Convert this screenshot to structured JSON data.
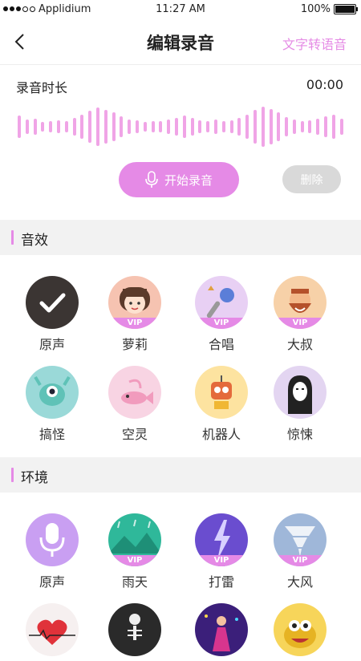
{
  "status_bar": {
    "carrier": "Applidium",
    "time": "11:27 AM",
    "battery": "100%"
  },
  "navbar": {
    "title": "编辑录音",
    "action": "文字转语音"
  },
  "recording": {
    "duration_label": "录音时长",
    "duration_value": "00:00",
    "record_button": "开始录音",
    "delete_button": "删除"
  },
  "sections": {
    "effects": {
      "title": "音效",
      "items": [
        {
          "label": "原声",
          "vip": false,
          "bg": "#3b3533",
          "icon": "checkmark-icon"
        },
        {
          "label": "萝莉",
          "vip": true,
          "vip_label": "VIP",
          "bg": "#f6c3b1",
          "icon": "girl-face-icon"
        },
        {
          "label": "合唱",
          "vip": true,
          "vip_label": "VIP",
          "bg": "#e8d0f4",
          "icon": "microphone-icon"
        },
        {
          "label": "大叔",
          "vip": true,
          "vip_label": "VIP",
          "bg": "#f7d1a8",
          "icon": "bearded-man-icon"
        },
        {
          "label": "搞怪",
          "vip": false,
          "bg": "#9ad9d8",
          "icon": "monster-icon"
        },
        {
          "label": "空灵",
          "vip": false,
          "bg": "#f8d4e3",
          "icon": "fish-icon"
        },
        {
          "label": "机器人",
          "vip": false,
          "bg": "#fde3a0",
          "icon": "robot-icon"
        },
        {
          "label": "惊悚",
          "vip": false,
          "bg": "#e3d5f1",
          "icon": "ghost-mask-icon"
        }
      ]
    },
    "environment": {
      "title": "环境",
      "items": [
        {
          "label": "原声",
          "vip": false,
          "bg": "#c99ff2",
          "icon": "studio-mic-icon"
        },
        {
          "label": "雨天",
          "vip": true,
          "vip_label": "VIP",
          "bg": "#2fb89a",
          "icon": "rain-mountain-icon"
        },
        {
          "label": "打雷",
          "vip": true,
          "vip_label": "VIP",
          "bg": "#6a4dcf",
          "icon": "lightning-icon"
        },
        {
          "label": "大风",
          "vip": true,
          "vip_label": "VIP",
          "bg": "#9fb7d9",
          "icon": "tornado-icon"
        },
        {
          "label": "",
          "vip": false,
          "bg": "#f6f0f0",
          "icon": "heart-pulse-icon"
        },
        {
          "label": "",
          "vip": false,
          "bg": "#2a2a2a",
          "icon": "skeleton-icon"
        },
        {
          "label": "",
          "vip": false,
          "bg": "#3b1f7a",
          "icon": "disco-icon"
        },
        {
          "label": "",
          "vip": false,
          "bg": "#f7d55a",
          "icon": "monster-smile-icon"
        }
      ]
    }
  },
  "colors": {
    "accent": "#e58ae6",
    "wave": "#f0a4e6",
    "delete_bg": "#d9d9d9"
  }
}
